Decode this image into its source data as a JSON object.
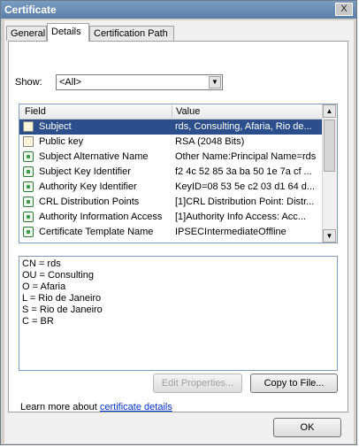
{
  "window": {
    "title": "Certificate",
    "close_label": "X"
  },
  "tabs": [
    {
      "label": "General"
    },
    {
      "label": "Details"
    },
    {
      "label": "Certification Path"
    }
  ],
  "show": {
    "label": "Show:",
    "value": "<All>"
  },
  "list": {
    "headers": {
      "field": "Field",
      "value": "Value"
    },
    "rows": [
      {
        "field": "Subject",
        "value": "rds, Consulting, Afaria, Rio de...",
        "icon": "certificate-icon"
      },
      {
        "field": "Public key",
        "value": "RSA (2048 Bits)",
        "icon": "certificate-icon"
      },
      {
        "field": "Subject Alternative Name",
        "value": "Other Name:Principal Name=rds",
        "icon": "extension-icon"
      },
      {
        "field": "Subject Key Identifier",
        "value": "f2 4c 52 85 3a ba 50 1e 7a cf ...",
        "icon": "extension-icon"
      },
      {
        "field": "Authority Key Identifier",
        "value": "KeyID=08 53 5e c2 03 d1 64 d...",
        "icon": "extension-icon"
      },
      {
        "field": "CRL Distribution Points",
        "value": "[1]CRL Distribution Point: Distr...",
        "icon": "extension-icon"
      },
      {
        "field": "Authority Information Access",
        "value": "[1]Authority Info Access: Acc...",
        "icon": "extension-icon"
      },
      {
        "field": "Certificate Template Name",
        "value": "IPSECIntermediateOffline",
        "icon": "extension-icon"
      }
    ]
  },
  "details": {
    "lines": [
      "CN = rds",
      "OU = Consulting",
      "O = Afaria",
      "L = Rio de Janeiro",
      "S = Rio de Janeiro",
      "C = BR"
    ]
  },
  "buttons": {
    "edit_properties": "Edit Properties...",
    "copy_to_file": "Copy to File...",
    "ok": "OK"
  },
  "learn": {
    "prefix": "Learn more about",
    "link": "certificate details"
  }
}
